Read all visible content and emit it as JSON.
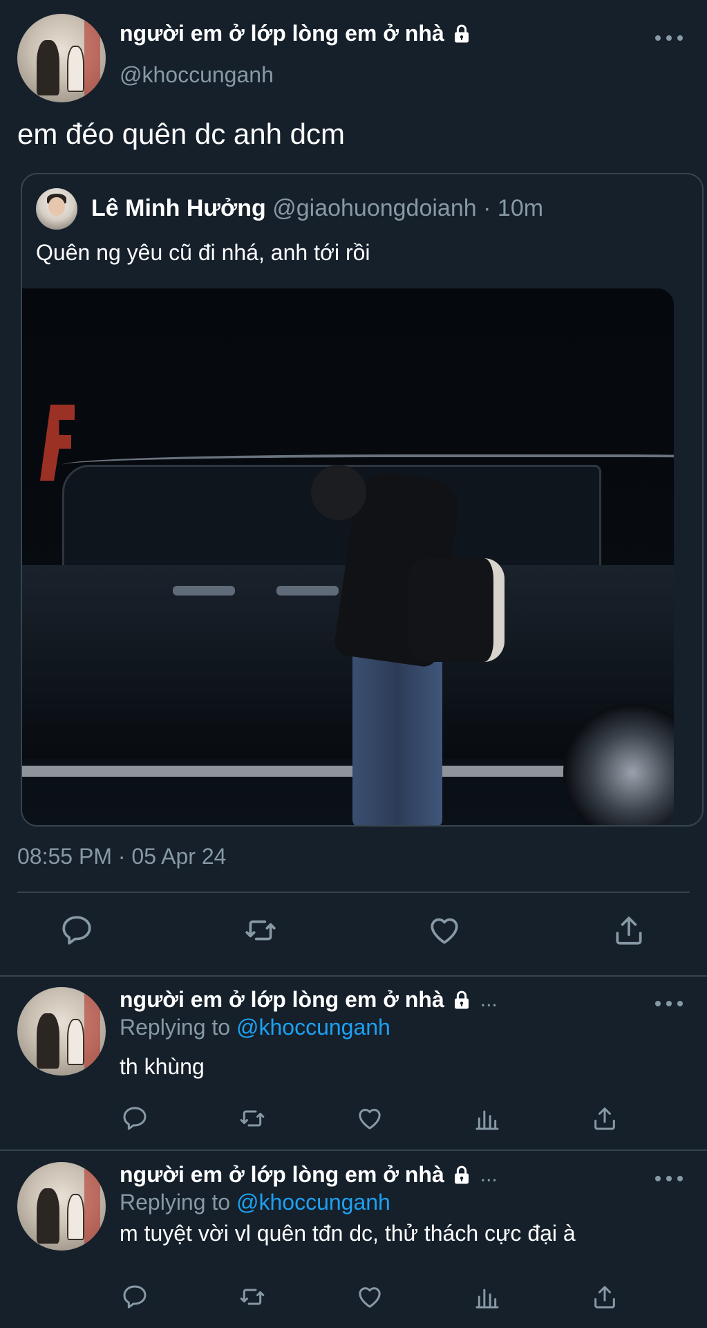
{
  "tweet": {
    "display_name": "người em ở lớp lòng em ở nhà",
    "handle": "@khoccunganh",
    "text": "em đéo quên dc anh dcm",
    "meta": "08:55 PM · 05 Apr 24",
    "icons": {
      "lock": "lock-icon",
      "more": "more-icon",
      "reply": "reply-icon",
      "retweet": "retweet-icon",
      "like": "heart-icon",
      "share": "share-icon"
    }
  },
  "quote": {
    "name": "Lê Minh Hưởng",
    "handle": "@giaohuongdoianh",
    "separator": "·",
    "time": "10m",
    "text": "Quên ng yêu cũ đi nhá, anh tới rồi"
  },
  "replies": [
    {
      "display_name": "người em ở lớp lòng em ở nhà",
      "ellipsis": "...",
      "replying_prefix": "Replying to",
      "replying_to": "@khoccunganh",
      "text": "th khùng"
    },
    {
      "display_name": "người em ở lớp lòng em ở nhà",
      "ellipsis": "...",
      "replying_prefix": "Replying to",
      "replying_to": "@khoccunganh",
      "text": "m tuyệt vời vl quên tđn dc, thử thách cực đại à"
    }
  ],
  "colors": {
    "background": "#15202b",
    "text": "#ffffff",
    "muted": "#8899a6",
    "border": "#38444d",
    "link": "#1da1f2"
  }
}
